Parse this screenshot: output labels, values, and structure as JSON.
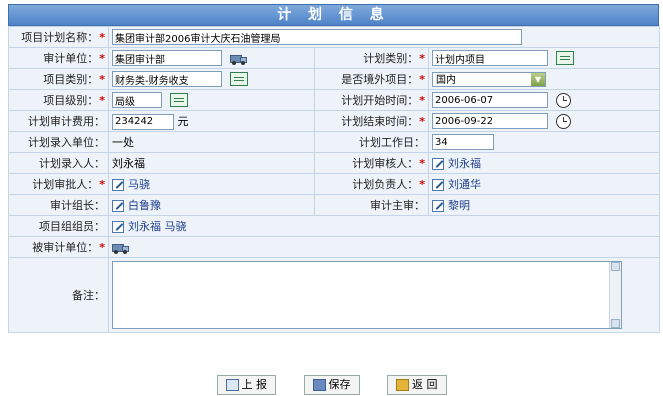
{
  "page": {
    "title": "计 划 信 息"
  },
  "form": {
    "plan_name": {
      "label": "项目计划名称：",
      "value": "集团审计部2006审计大庆石油管理局"
    },
    "audit_unit": {
      "label": "审计单位：",
      "value": "集团审计部"
    },
    "plan_category": {
      "label": "计划类别：",
      "value": "计划内项目"
    },
    "project_category": {
      "label": "项目类别：",
      "value": "财务类-财务收支"
    },
    "is_overseas": {
      "label": "是否境外项目：",
      "value": "国内"
    },
    "project_level": {
      "label": "项目级别：",
      "value": "局级"
    },
    "plan_start": {
      "label": "计划开始时间：",
      "value": "2006-06-07"
    },
    "audit_cost": {
      "label": "计划审计费用：",
      "value": "234242",
      "unit": "元"
    },
    "plan_end": {
      "label": "计划结束时间：",
      "value": "2006-09-22"
    },
    "entry_unit": {
      "label": "计划录入单位：",
      "value": "一处"
    },
    "work_days": {
      "label": "计划工作日：",
      "value": "34"
    },
    "entry_person": {
      "label": "计划录入人：",
      "value": "刘永福"
    },
    "reviewer": {
      "label": "计划审核人：",
      "value": "刘永福"
    },
    "approver": {
      "label": "计划审批人：",
      "value": "马骁"
    },
    "responsible": {
      "label": "计划负责人：",
      "value": "刘通华"
    },
    "team_leader": {
      "label": "审计组长：",
      "value": "白鲁豫"
    },
    "chief_auditor": {
      "label": "审计主审：",
      "value": "黎明"
    },
    "team_members": {
      "label": "项目组组员：",
      "value": "刘永福  马骁"
    },
    "audited_unit": {
      "label": "被审计单位：",
      "value": ""
    },
    "remarks": {
      "label": "备注：",
      "value": ""
    }
  },
  "buttons": {
    "submit": "上 报",
    "save": "保存",
    "back": "返 回"
  },
  "required_mark": "*"
}
